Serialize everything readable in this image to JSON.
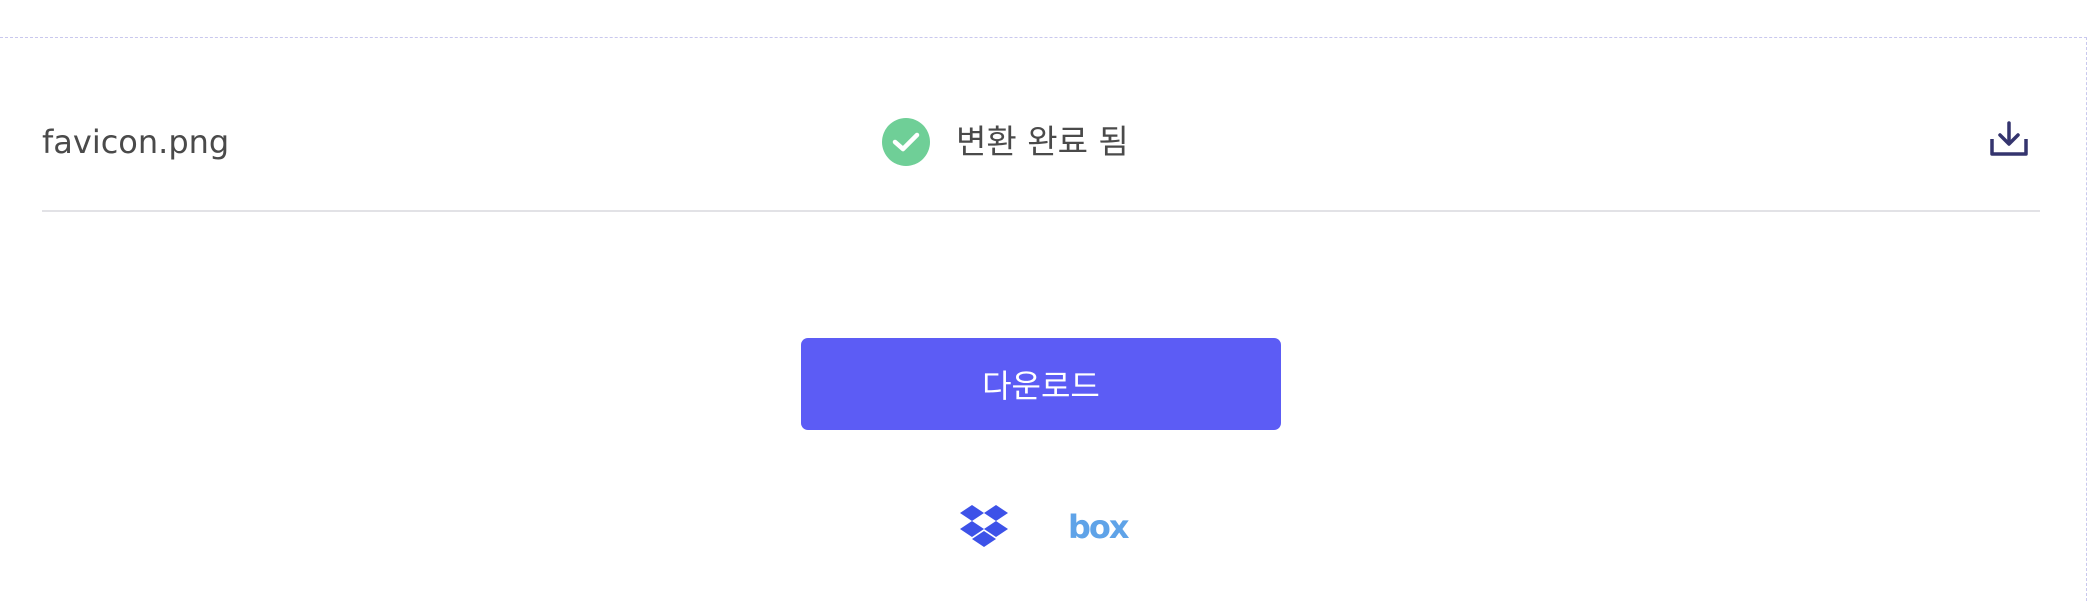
{
  "file": {
    "name": "favicon.png",
    "status_text": "변환 완료 됨",
    "status_icon": "check-circle-icon",
    "status_color": "#6fcf97",
    "download_icon": "download-icon"
  },
  "actions": {
    "download_label": "다운로드",
    "download_color": "#5c5cf5"
  },
  "cloud": {
    "dropbox_icon": "dropbox-icon",
    "box_label": "box",
    "box_color": "#5fa3e8"
  }
}
